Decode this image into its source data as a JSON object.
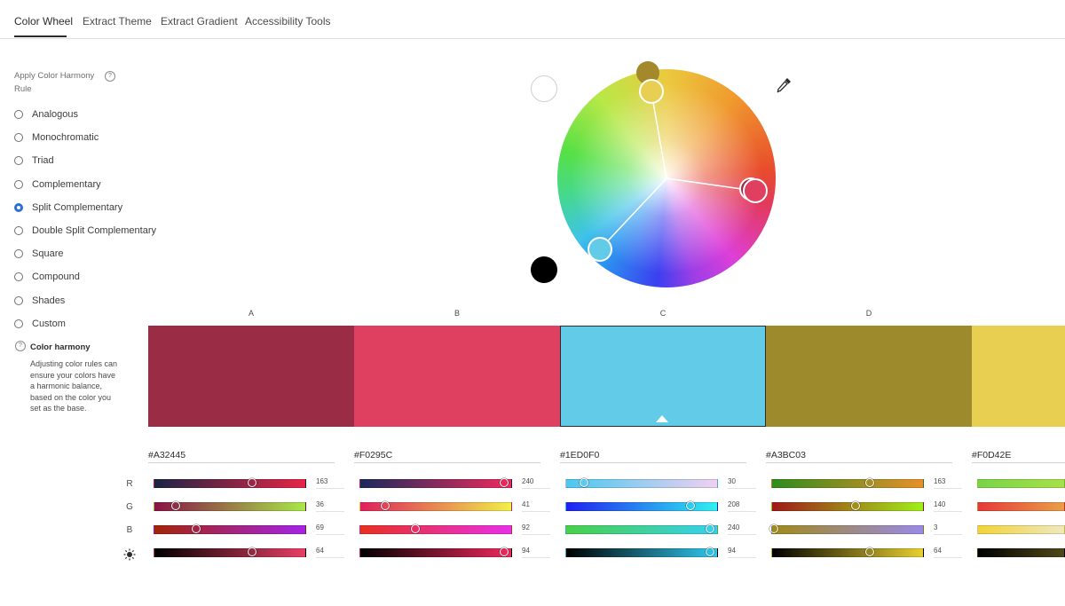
{
  "tabs": [
    {
      "label": "Color Wheel"
    },
    {
      "label": "Extract Theme"
    },
    {
      "label": "Extract Gradient"
    },
    {
      "label": "Accessibility Tools"
    }
  ],
  "sidebar": {
    "title": "Apply Color Harmony Rule",
    "help_glyph": "?",
    "rules": [
      {
        "label": "Analogous",
        "selected": false
      },
      {
        "label": "Monochromatic",
        "selected": false
      },
      {
        "label": "Triad",
        "selected": false
      },
      {
        "label": "Complementary",
        "selected": false
      },
      {
        "label": "Split Complementary",
        "selected": true
      },
      {
        "label": "Double Split Complementary",
        "selected": false
      },
      {
        "label": "Square",
        "selected": false
      },
      {
        "label": "Compound",
        "selected": false
      },
      {
        "label": "Shades",
        "selected": false
      },
      {
        "label": "Custom",
        "selected": false
      }
    ],
    "help_title": "Color harmony",
    "help_text": "Adjusting color rules can ensure your colors have a harmonic balance, based on the color you set as the base."
  },
  "wheel": {
    "icons": {
      "eyedropper": "eyedropper-icon"
    },
    "white_swatch": "#ffffff",
    "black_swatch": "#000000"
  },
  "row_labels": [
    "R",
    "G",
    "B"
  ],
  "brightness_icon": "brightness-icon",
  "swatches": [
    {
      "label": "A",
      "hex": "#A32445",
      "color": "#9b2c45",
      "rgb": [
        163,
        36,
        69
      ],
      "brightness": 64,
      "bars": [
        "linear-gradient(90deg,#1a2445,#e82545)",
        "linear-gradient(90deg,#8a1245,#a8e848)",
        "linear-gradient(90deg,#a42408,#a424e8)",
        "linear-gradient(90deg,#000000,#e84064)"
      ]
    },
    {
      "label": "B",
      "hex": "#F0295C",
      "color": "#e04060",
      "rgb": [
        240,
        41,
        92
      ],
      "brightness": 94,
      "bars": [
        "linear-gradient(90deg,#1a2a5c,#f0295c)",
        "linear-gradient(90deg,#e0205c,#f0f048)",
        "linear-gradient(90deg,#e83020,#e830e8)",
        "linear-gradient(90deg,#000000,#f0295c)"
      ]
    },
    {
      "label": "C",
      "hex": "#1ED0F0",
      "color": "#62cce8",
      "rgb": [
        30,
        208,
        240
      ],
      "brightness": 94,
      "selected": true,
      "bars": [
        "linear-gradient(90deg,#4ac8f0,#f0d0f0)",
        "linear-gradient(90deg,#2020f0,#30f0f0)",
        "linear-gradient(90deg,#48d048,#38d0f0)",
        "linear-gradient(90deg,#000000,#30c8f0)"
      ]
    },
    {
      "label": "D",
      "hex": "#A3BC03",
      "color": "#9d8a2c",
      "rgb": [
        163,
        140,
        3
      ],
      "brightness": 64,
      "bars": [
        "linear-gradient(90deg,#2e8c1c,#e89028)",
        "linear-gradient(90deg,#a01818,#a0f018)",
        "linear-gradient(90deg,#a08a18,#9a8ae8)",
        "linear-gradient(90deg,#000000,#e8d030)"
      ]
    },
    {
      "label": "",
      "hex": "#F0D42E",
      "color": "#e8cf52",
      "bars": [
        "linear-gradient(90deg,#78d448,#a8e048)",
        "linear-gradient(90deg,#e83838,#e8a048)",
        "linear-gradient(90deg,#f0d438,#f0e8c0)",
        "linear-gradient(90deg,#000000,#504818)"
      ]
    }
  ]
}
